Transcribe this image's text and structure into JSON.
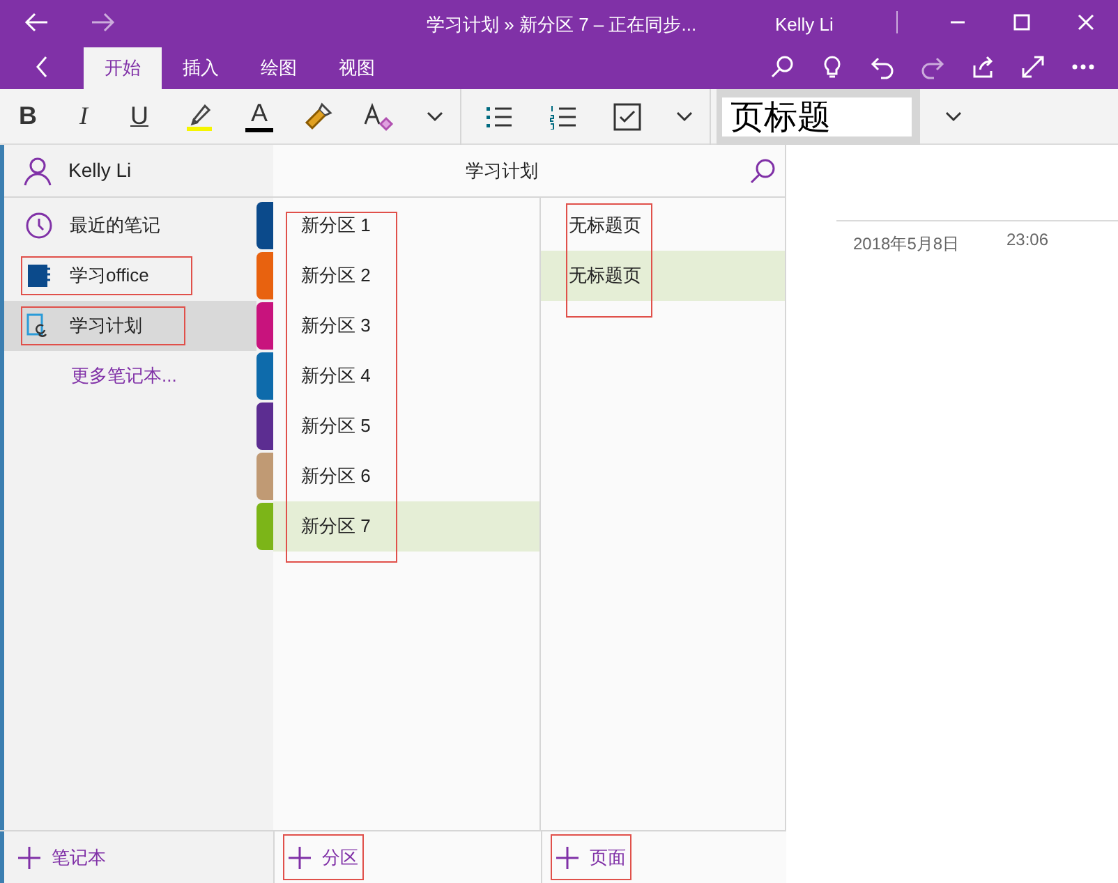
{
  "window": {
    "title": "学习计划 » 新分区 7 – 正在同步...",
    "user": "Kelly Li"
  },
  "ribbon_tabs": [
    {
      "label": "开始",
      "selected": true
    },
    {
      "label": "插入",
      "selected": false
    },
    {
      "label": "绘图",
      "selected": false
    },
    {
      "label": "视图",
      "selected": false
    }
  ],
  "format_buttons": [
    "B",
    "I",
    "U"
  ],
  "font_color_button": "A",
  "title_field": {
    "value": "页标题"
  },
  "account": {
    "name": "Kelly Li"
  },
  "notebooks": [
    {
      "kind": "recent",
      "label": "最近的笔记",
      "selected": false,
      "annotated": false
    },
    {
      "kind": "notebook",
      "label": "学习office",
      "selected": false,
      "annotated": true
    },
    {
      "kind": "syncing",
      "label": "学习计划",
      "selected": true,
      "annotated": true
    }
  ],
  "more_notebooks": "更多笔记本...",
  "section_header": "学习计划",
  "sections_annotated": true,
  "sections": [
    {
      "label": "新分区 1",
      "color": "#0b4a8b",
      "selected": false
    },
    {
      "label": "新分区 2",
      "color": "#e8620f",
      "selected": false
    },
    {
      "label": "新分区 3",
      "color": "#c8137d",
      "selected": false
    },
    {
      "label": "新分区 4",
      "color": "#0e6bab",
      "selected": false
    },
    {
      "label": "新分区 5",
      "color": "#5c2d91",
      "selected": false
    },
    {
      "label": "新分区 6",
      "color": "#c09a74",
      "selected": false
    },
    {
      "label": "新分区 7",
      "color": "#7cb518",
      "selected": true
    }
  ],
  "pages_annotated": true,
  "pages": [
    {
      "label": "无标题页",
      "selected": false
    },
    {
      "label": "无标题页",
      "selected": true
    }
  ],
  "page": {
    "date": "2018年5月8日",
    "time": "23:06"
  },
  "footer": [
    {
      "label": "笔记本",
      "annotated": false
    },
    {
      "label": "分区",
      "annotated": true
    },
    {
      "label": "页面",
      "annotated": true
    }
  ]
}
